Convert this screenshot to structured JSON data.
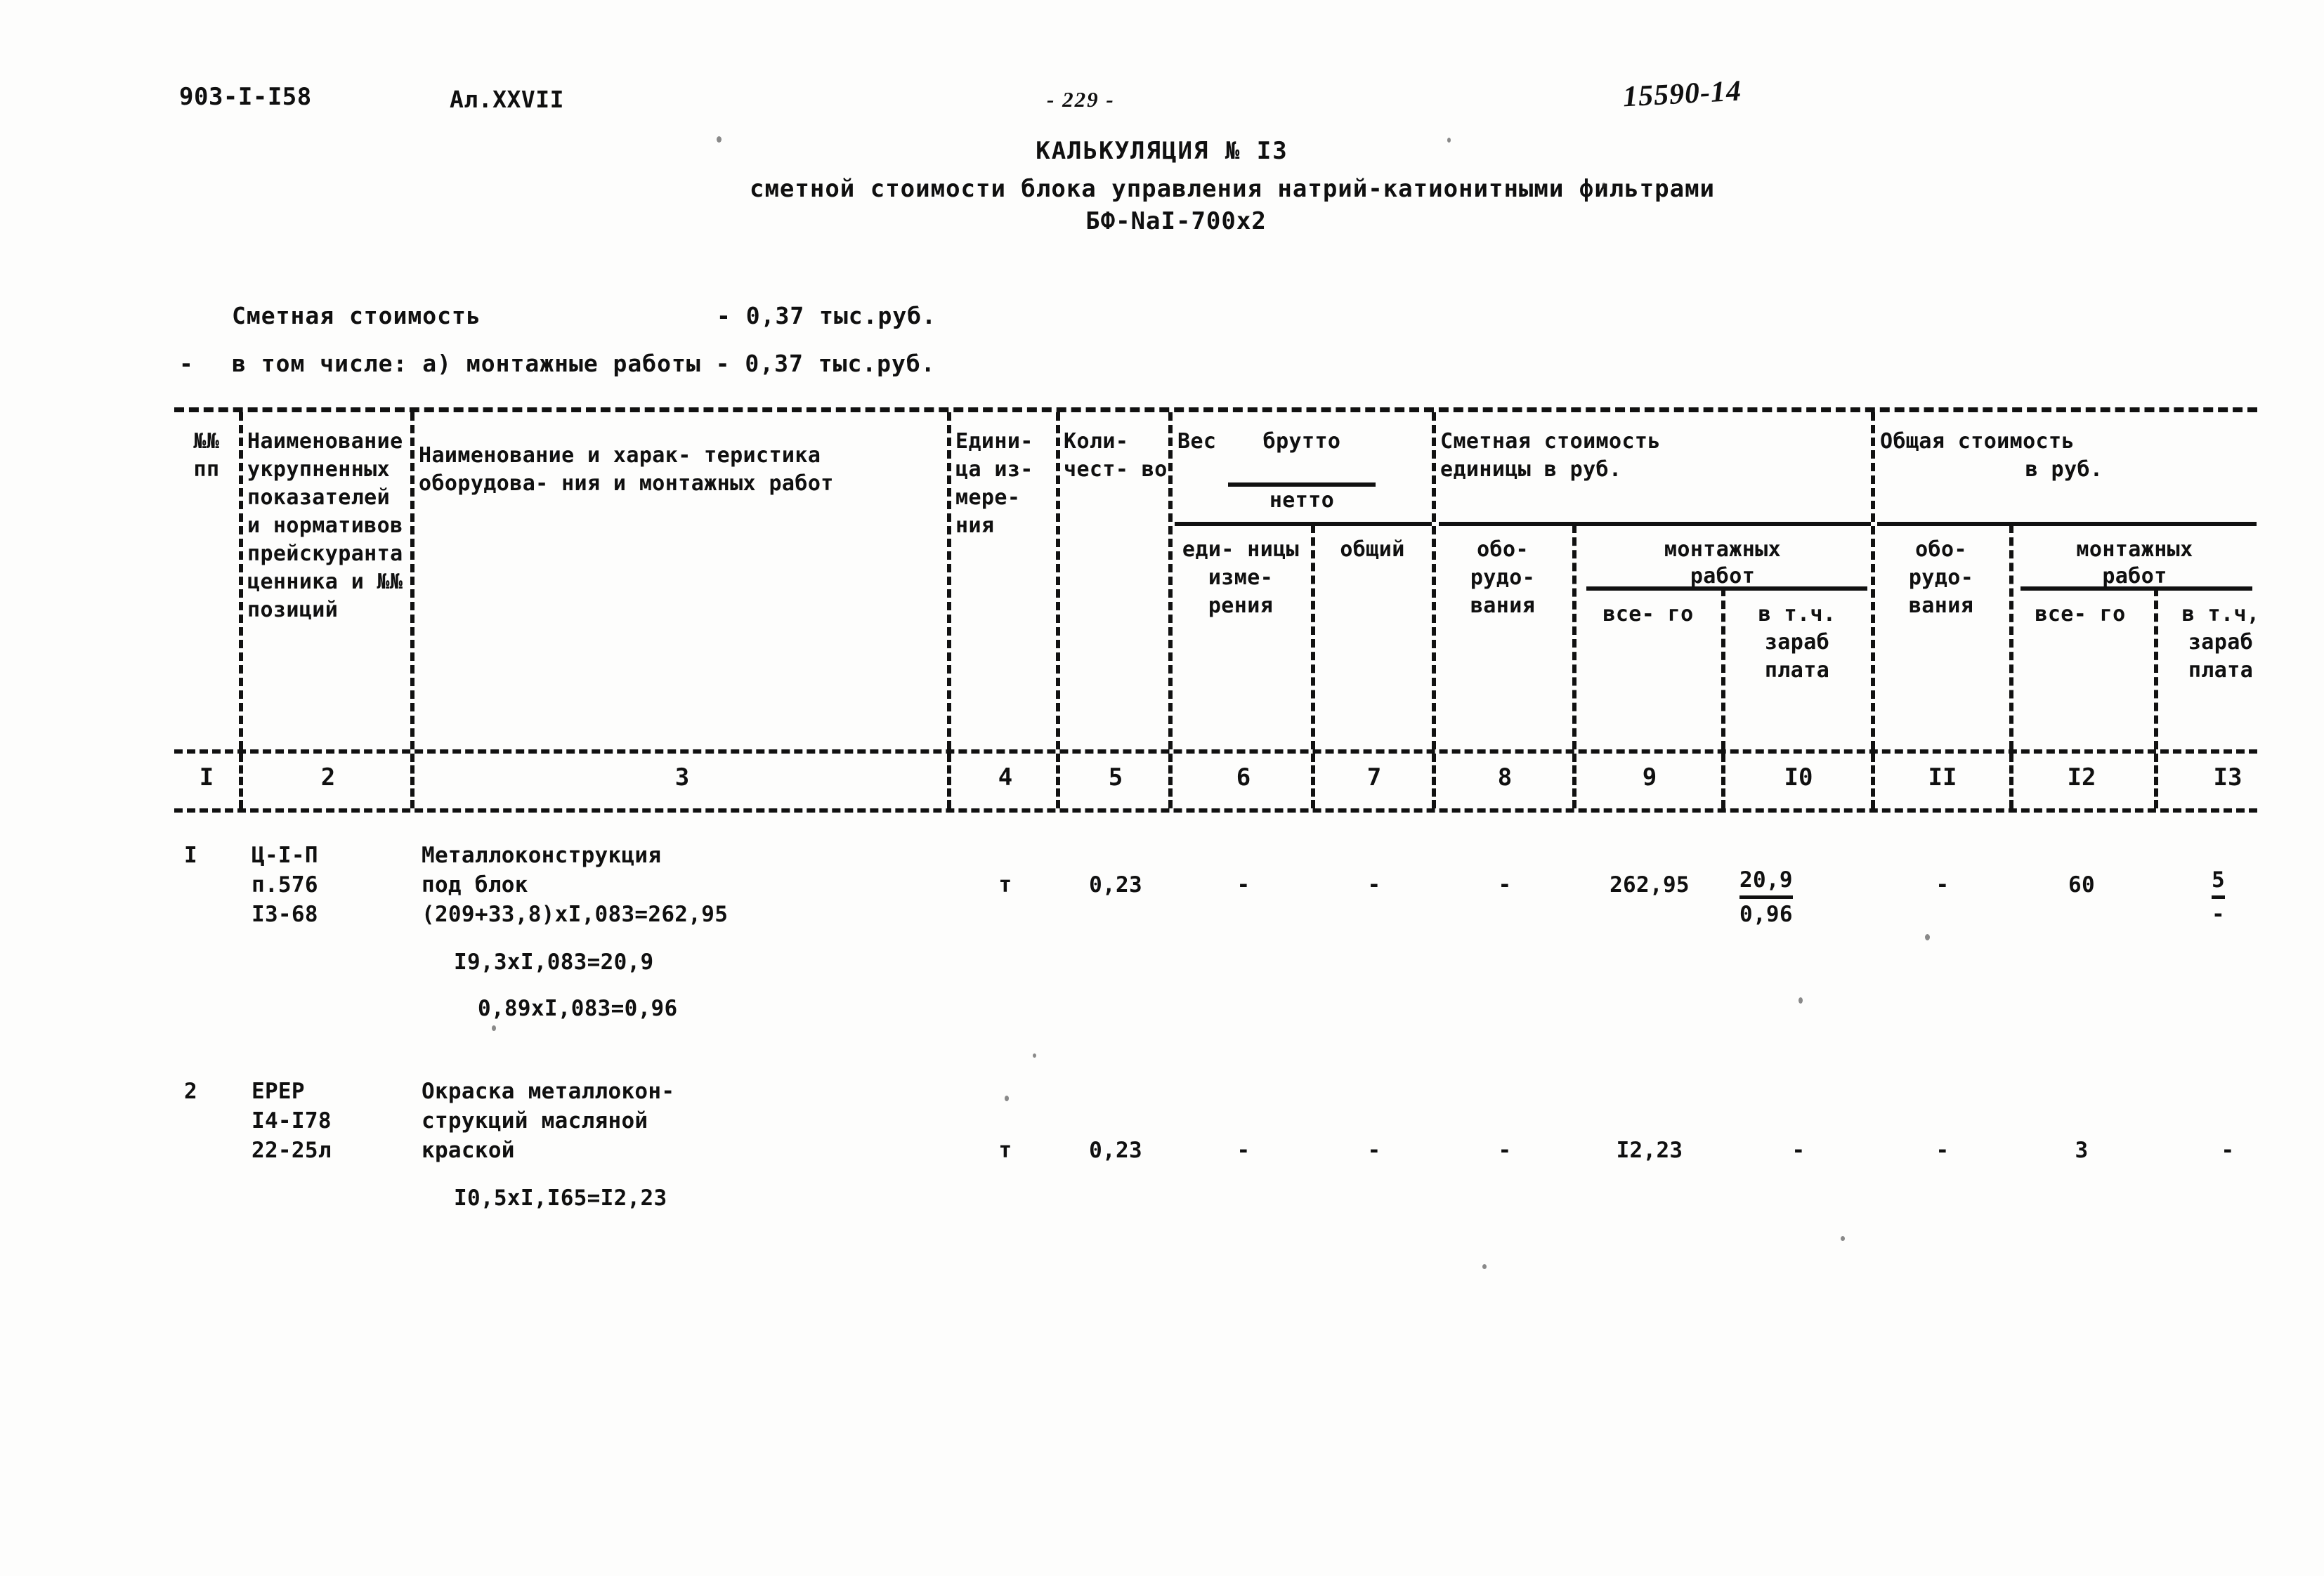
{
  "header": {
    "doc_code": "903-I-I58",
    "album_code": "Ал.XXVII",
    "page_number": "- 229 -",
    "archive_number": "15590-14"
  },
  "title": {
    "line1": "КАЛЬКУЛЯЦИЯ № I3",
    "line2": "сметной стоимости блока управления натрий-катионитными фильтрами",
    "line3": "БФ-NaI-700х2"
  },
  "summary": {
    "label_total": "Сметная стоимость",
    "value_total": "- 0,37 тыс.руб.",
    "dash_prefix": "-",
    "line_breakdown": "в том числе: а) монтажные работы - 0,37 тыс.руб."
  },
  "table": {
    "headers": {
      "col1": "№№\nпп",
      "col2": "Наименование\nукрупненных\nпоказателей\nи нормативов\nпрейскуранта\nценника и\n№№ позиций",
      "col3": "Наименование и харак-\nтеристика оборудова-\nния и монтажных работ",
      "col4": "Едини-\nца из-\nмере-\nния",
      "col5": "Коли-\nчест-\nво",
      "col6_group_prefix": "Вес",
      "col6_group_brutto": "брутто",
      "col6_group_netto": "нетто",
      "col6_sub": "еди-\nницы\nизме-\nрения",
      "col7_sub": "общий",
      "col8_group_line1": "Сметная стоимость",
      "col8_group_line2": "единицы в руб.",
      "col8_sub": "обо-\nрудо-\nвания",
      "col9_group_line1": "монтажных",
      "col9_group_line2": "работ",
      "col9_sub": "все-\nго",
      "col10_sub": "в т.ч.\nзараб\nплата",
      "col11_group_line1": "Общая стоимость",
      "col11_group_line2": "в руб.",
      "col11_sub": "обо-\nрудо-\nвания",
      "col12_group_line1": "монтажных",
      "col12_group_line2": "работ",
      "col12_sub": "все-\nго",
      "col13_sub": "в т.ч,\nзараб\nплата"
    },
    "column_numbers": [
      "I",
      "2",
      "3",
      "4",
      "5",
      "6",
      "7",
      "8",
      "9",
      "I0",
      "II",
      "I2",
      "I3"
    ],
    "rows": [
      {
        "num": "I",
        "ref": "Ц-I-П\nп.576\nI3-68",
        "name_line1": "Металлоконструкция",
        "name_line2": "под блок",
        "calc_line1": "(209+33,8)хI,083=262,95",
        "calc_line2": "I9,3хI,083=20,9",
        "calc_line3": "0,89хI,083=0,96",
        "unit": "т",
        "qty": "0,23",
        "weight_unit": "-",
        "weight_total": "-",
        "cost_equip": "-",
        "cost_work_total": "262,95",
        "cost_work_wage_num": "20,9",
        "cost_work_wage_den": "0,96",
        "total_equip": "-",
        "total_work_total": "60",
        "total_work_wage_num": "5",
        "total_work_wage_den": "-"
      },
      {
        "num": "2",
        "ref": "ЕРЕР\nI4-I78\n22-25л",
        "name_line1": "Окраска металлокон-",
        "name_line2": "струкций масляной",
        "name_line3": "краской",
        "calc_line1": "I0,5хI,I65=I2,23",
        "unit": "т",
        "qty": "0,23",
        "weight_unit": "-",
        "weight_total": "-",
        "cost_equip": "-",
        "cost_work_total": "I2,23",
        "cost_work_wage": "-",
        "total_equip": "-",
        "total_work_total": "3",
        "total_work_wage": "-"
      }
    ]
  }
}
